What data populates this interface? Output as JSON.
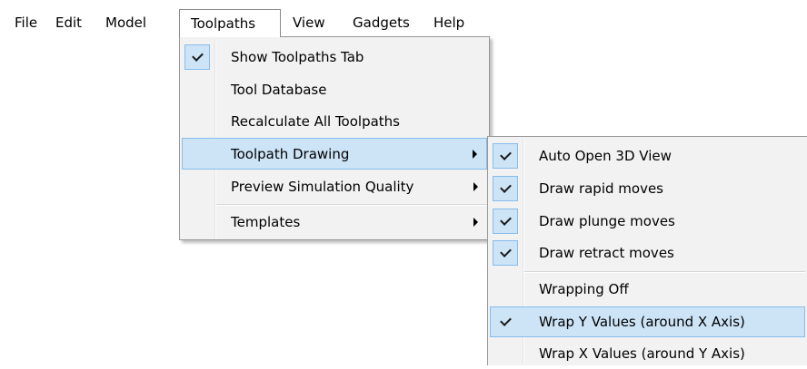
{
  "menubar": {
    "items": [
      {
        "label": "File"
      },
      {
        "label": "Edit"
      },
      {
        "label": "Model"
      },
      {
        "label": "Toolpaths"
      },
      {
        "label": "View"
      },
      {
        "label": "Gadgets"
      },
      {
        "label": "Help"
      }
    ],
    "open_item": "Toolpaths"
  },
  "toolpaths_menu": {
    "items": [
      {
        "label": "Show Toolpaths Tab",
        "checked": true
      },
      {
        "label": "Tool Database"
      },
      {
        "label": "Recalculate All Toolpaths"
      },
      {
        "label": "Toolpath Drawing",
        "submenu": true,
        "highlighted": true
      },
      {
        "label": "Preview Simulation Quality",
        "submenu": true
      },
      {
        "label": "Templates",
        "submenu": true
      }
    ]
  },
  "toolpath_drawing_submenu": {
    "items": [
      {
        "label": "Auto Open 3D View",
        "checked": true
      },
      {
        "label": "Draw rapid moves",
        "checked": true
      },
      {
        "label": "Draw plunge moves",
        "checked": true
      },
      {
        "label": "Draw retract moves",
        "checked": true
      },
      {
        "label": "Wrapping Off"
      },
      {
        "label": "Wrap Y Values (around X Axis)",
        "checked": true,
        "highlighted": true
      },
      {
        "label": "Wrap X Values (around Y Axis)"
      }
    ]
  },
  "icons": {
    "check": "checkmark-icon",
    "submenu_arrow": "chevron-right-icon"
  },
  "colors": {
    "highlight_fill": "#cde4f7",
    "highlight_border": "#87bcea",
    "menu_background": "#f2f2f2",
    "menu_border": "#979797"
  }
}
